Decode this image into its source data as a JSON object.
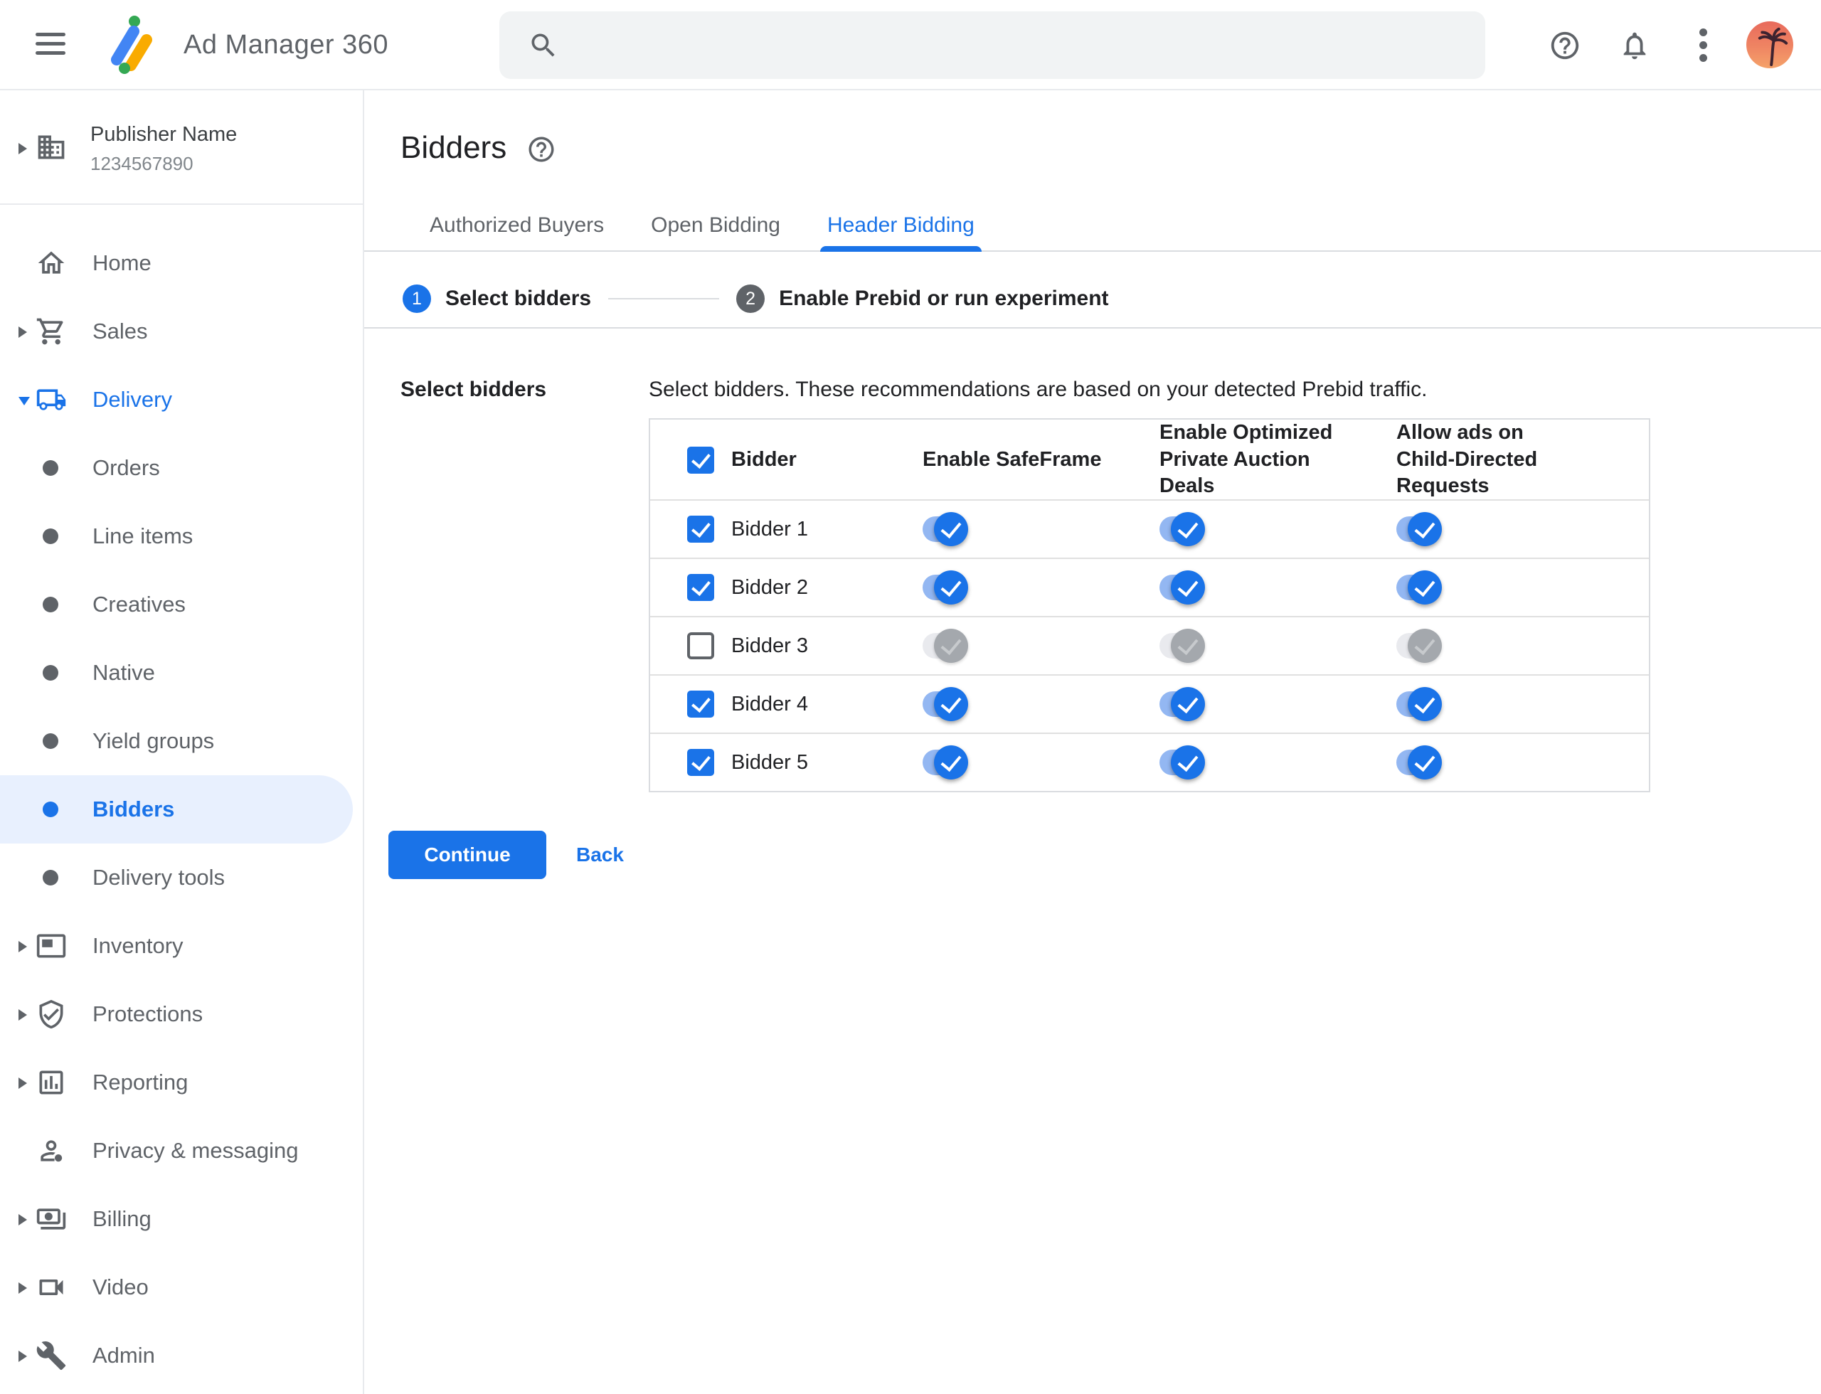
{
  "topbar": {
    "app_name": "Ad Manager 360",
    "search": {
      "value": ""
    },
    "icons": [
      "menu-icon",
      "search-icon",
      "help-icon",
      "notifications-icon",
      "more-vert-icon",
      "avatar"
    ]
  },
  "colors": {
    "accent": "#1a73e8",
    "selected_item_bg": "#e8f0fe",
    "logo_blue": "#4285f4",
    "logo_yellow": "#f9ab00",
    "logo_green": "#34a853",
    "disabled_toggle_thumb": "#a4a8ad"
  },
  "sidebar": {
    "publisher": {
      "name": "Publisher Name",
      "id": "1234567890",
      "icon": "building-icon"
    },
    "items": [
      {
        "label": "Home",
        "icon": "home-icon",
        "arrow": "none",
        "level": 0
      },
      {
        "label": "Sales",
        "icon": "cart-icon",
        "arrow": "collapsed",
        "level": 0
      },
      {
        "label": "Delivery",
        "icon": "truck-icon",
        "arrow": "expanded",
        "level": 0,
        "active": true
      },
      {
        "label": "Orders",
        "level": 1
      },
      {
        "label": "Line items",
        "level": 1
      },
      {
        "label": "Creatives",
        "level": 1
      },
      {
        "label": "Native",
        "level": 1
      },
      {
        "label": "Yield groups",
        "level": 1
      },
      {
        "label": "Bidders",
        "level": 1,
        "selected": true
      },
      {
        "label": "Delivery tools",
        "level": 1
      },
      {
        "label": "Inventory",
        "icon": "inventory-icon",
        "arrow": "collapsed",
        "level": 0
      },
      {
        "label": "Protections",
        "icon": "shield-icon",
        "arrow": "collapsed",
        "level": 0
      },
      {
        "label": "Reporting",
        "icon": "report-icon",
        "arrow": "collapsed",
        "level": 0
      },
      {
        "label": "Privacy & messaging",
        "icon": "privacy-icon",
        "arrow": "none",
        "level": 0
      },
      {
        "label": "Billing",
        "icon": "billing-icon",
        "arrow": "collapsed",
        "level": 0
      },
      {
        "label": "Video",
        "icon": "video-icon",
        "arrow": "collapsed",
        "level": 0
      },
      {
        "label": "Admin",
        "icon": "admin-icon",
        "arrow": "collapsed",
        "level": 0
      }
    ]
  },
  "main": {
    "title": "Bidders",
    "tabs": [
      {
        "label": "Authorized Buyers",
        "active": false
      },
      {
        "label": "Open Bidding",
        "active": false
      },
      {
        "label": "Header Bidding",
        "active": true
      }
    ],
    "stepper": [
      {
        "number": "1",
        "label": "Select bidders",
        "state": "active"
      },
      {
        "number": "2",
        "label": "Enable Prebid or run experiment",
        "state": "inactive"
      }
    ],
    "section_label": "Select bidders",
    "description": "Select bidders. These recommendations are based on your detected Prebid traffic.",
    "table": {
      "select_all_checked": true,
      "columns": [
        "Bidder",
        "Enable SafeFrame",
        "Enable Optimized Private Auction Deals",
        "Allow ads on Child-Directed Requests"
      ],
      "rows": [
        {
          "name": "Bidder 1",
          "checked": true,
          "enabled": true,
          "safeframe_on": true,
          "optimized_on": true,
          "child_directed_on": true
        },
        {
          "name": "Bidder 2",
          "checked": true,
          "enabled": true,
          "safeframe_on": true,
          "optimized_on": true,
          "child_directed_on": true
        },
        {
          "name": "Bidder 3",
          "checked": false,
          "enabled": false,
          "safeframe_on": true,
          "optimized_on": true,
          "child_directed_on": true
        },
        {
          "name": "Bidder 4",
          "checked": true,
          "enabled": true,
          "safeframe_on": true,
          "optimized_on": true,
          "child_directed_on": true
        },
        {
          "name": "Bidder 5",
          "checked": true,
          "enabled": true,
          "safeframe_on": true,
          "optimized_on": true,
          "child_directed_on": true
        }
      ]
    },
    "buttons": {
      "continue": "Continue",
      "back": "Back"
    }
  }
}
